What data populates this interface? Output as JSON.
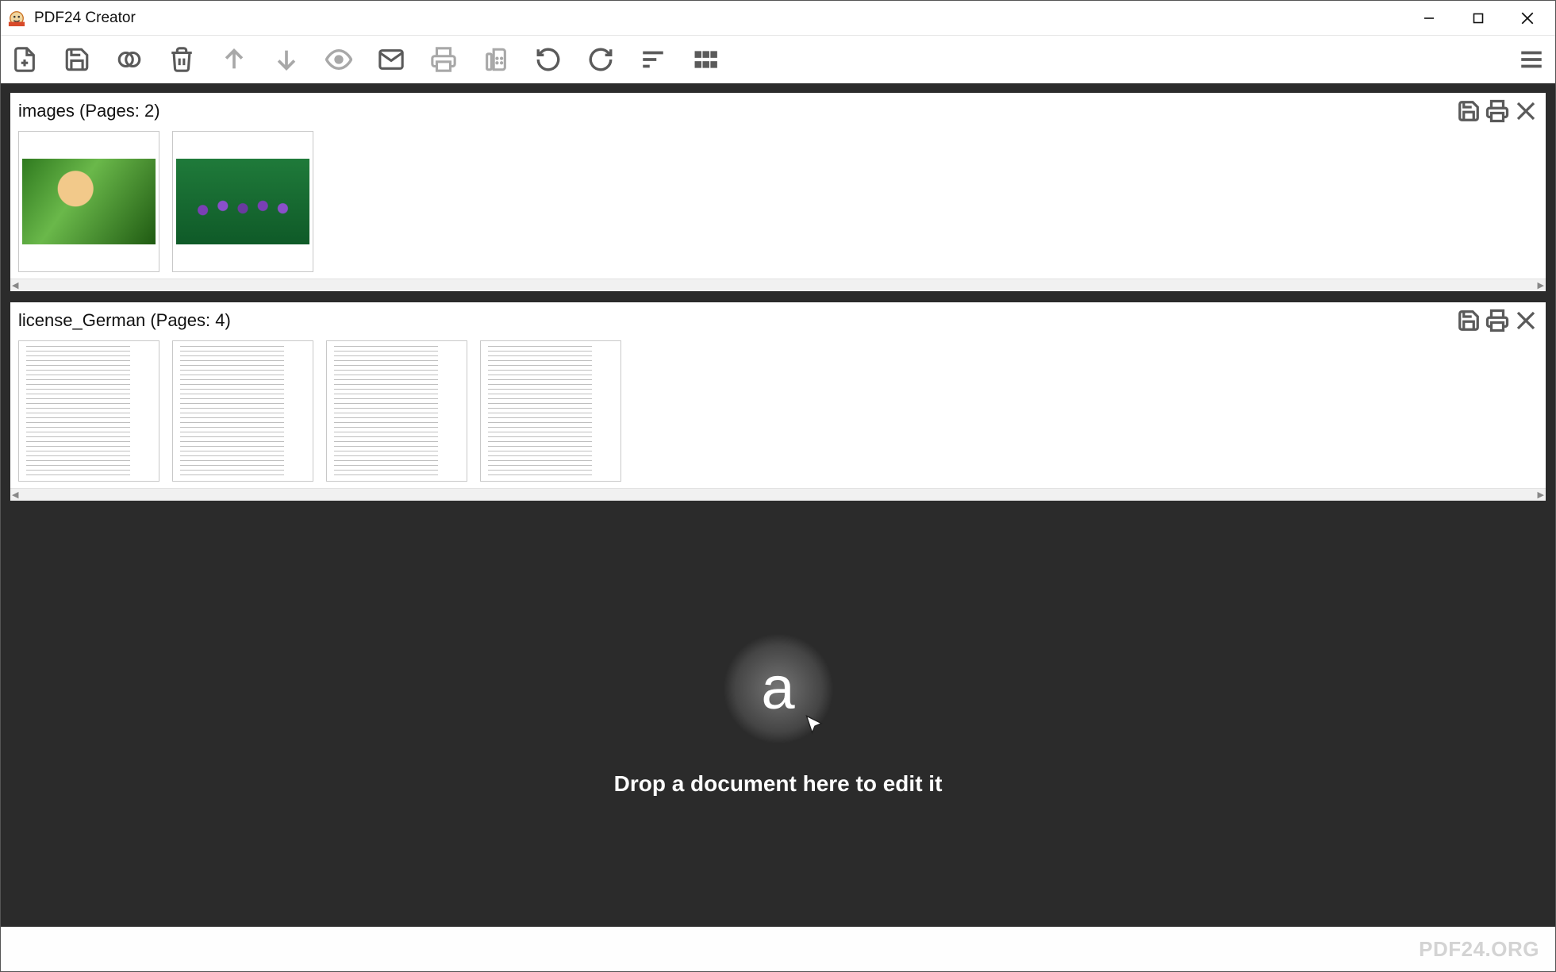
{
  "window": {
    "title": "PDF24 Creator"
  },
  "documents": [
    {
      "name": "images",
      "pages_label": "(Pages: 2)",
      "thumb_type": "image",
      "thumbs": [
        "leaf",
        "flowers"
      ]
    },
    {
      "name": "license_German",
      "pages_label": "(Pages: 4)",
      "thumb_type": "text",
      "thumbs": [
        "p1",
        "p2",
        "p3",
        "p4"
      ]
    }
  ],
  "drop_zone": {
    "text": "Drop a document here to edit it"
  },
  "footer": {
    "brand": "PDF24.ORG"
  }
}
